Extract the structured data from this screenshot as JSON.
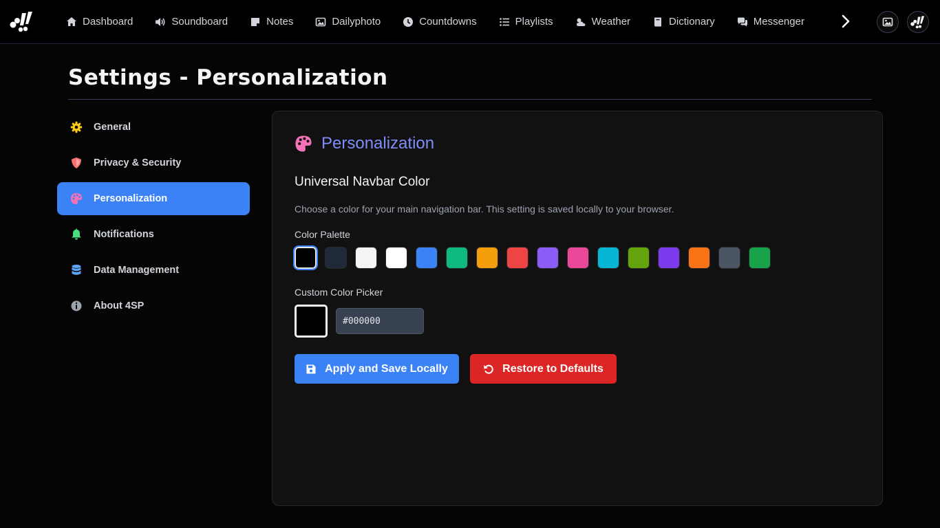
{
  "nav": {
    "tabs": [
      {
        "label": "Dashboard",
        "icon": "home-icon"
      },
      {
        "label": "Soundboard",
        "icon": "speaker-icon"
      },
      {
        "label": "Notes",
        "icon": "note-icon"
      },
      {
        "label": "Dailyphoto",
        "icon": "image-icon"
      },
      {
        "label": "Countdowns",
        "icon": "clock-icon"
      },
      {
        "label": "Playlists",
        "icon": "list-icon"
      },
      {
        "label": "Weather",
        "icon": "cloud-sun-icon"
      },
      {
        "label": "Dictionary",
        "icon": "book-icon"
      },
      {
        "label": "Messenger",
        "icon": "chat-icon"
      }
    ]
  },
  "page": {
    "title": "Settings - Personalization"
  },
  "sidebar": {
    "items": [
      {
        "label": "General",
        "icon": "gear-icon",
        "color": "#facc15"
      },
      {
        "label": "Privacy & Security",
        "icon": "shield-icon",
        "color": "#f87171"
      },
      {
        "label": "Personalization",
        "icon": "palette-icon",
        "color": "#f472b6",
        "active": true
      },
      {
        "label": "Notifications",
        "icon": "bell-icon",
        "color": "#4ade80"
      },
      {
        "label": "Data Management",
        "icon": "database-icon",
        "color": "#60a5fa"
      },
      {
        "label": "About 4SP",
        "icon": "info-icon",
        "color": "#9ca3af"
      }
    ]
  },
  "panel": {
    "title": "Personalization",
    "section_title": "Universal Navbar Color",
    "description": "Choose a color for your main navigation bar. This setting is saved locally to your browser.",
    "palette_label": "Color Palette",
    "palette": [
      "#000000",
      "#1f2937",
      "#f3f4f6",
      "#ffffff",
      "#3b82f6",
      "#10b981",
      "#f59e0b",
      "#ef4444",
      "#8b5cf6",
      "#ec4899",
      "#06b6d4",
      "#65a30d",
      "#7c3aed",
      "#f97316",
      "#4b5563",
      "#16a34a"
    ],
    "selected_color": "#000000",
    "picker_label": "Custom Color Picker",
    "hex_value": "#000000",
    "apply_label": "Apply and Save Locally",
    "restore_label": "Restore to Defaults"
  },
  "colors": {
    "accent": "#3b82f6",
    "danger": "#dc2626",
    "panel_title": "#818cf8"
  }
}
